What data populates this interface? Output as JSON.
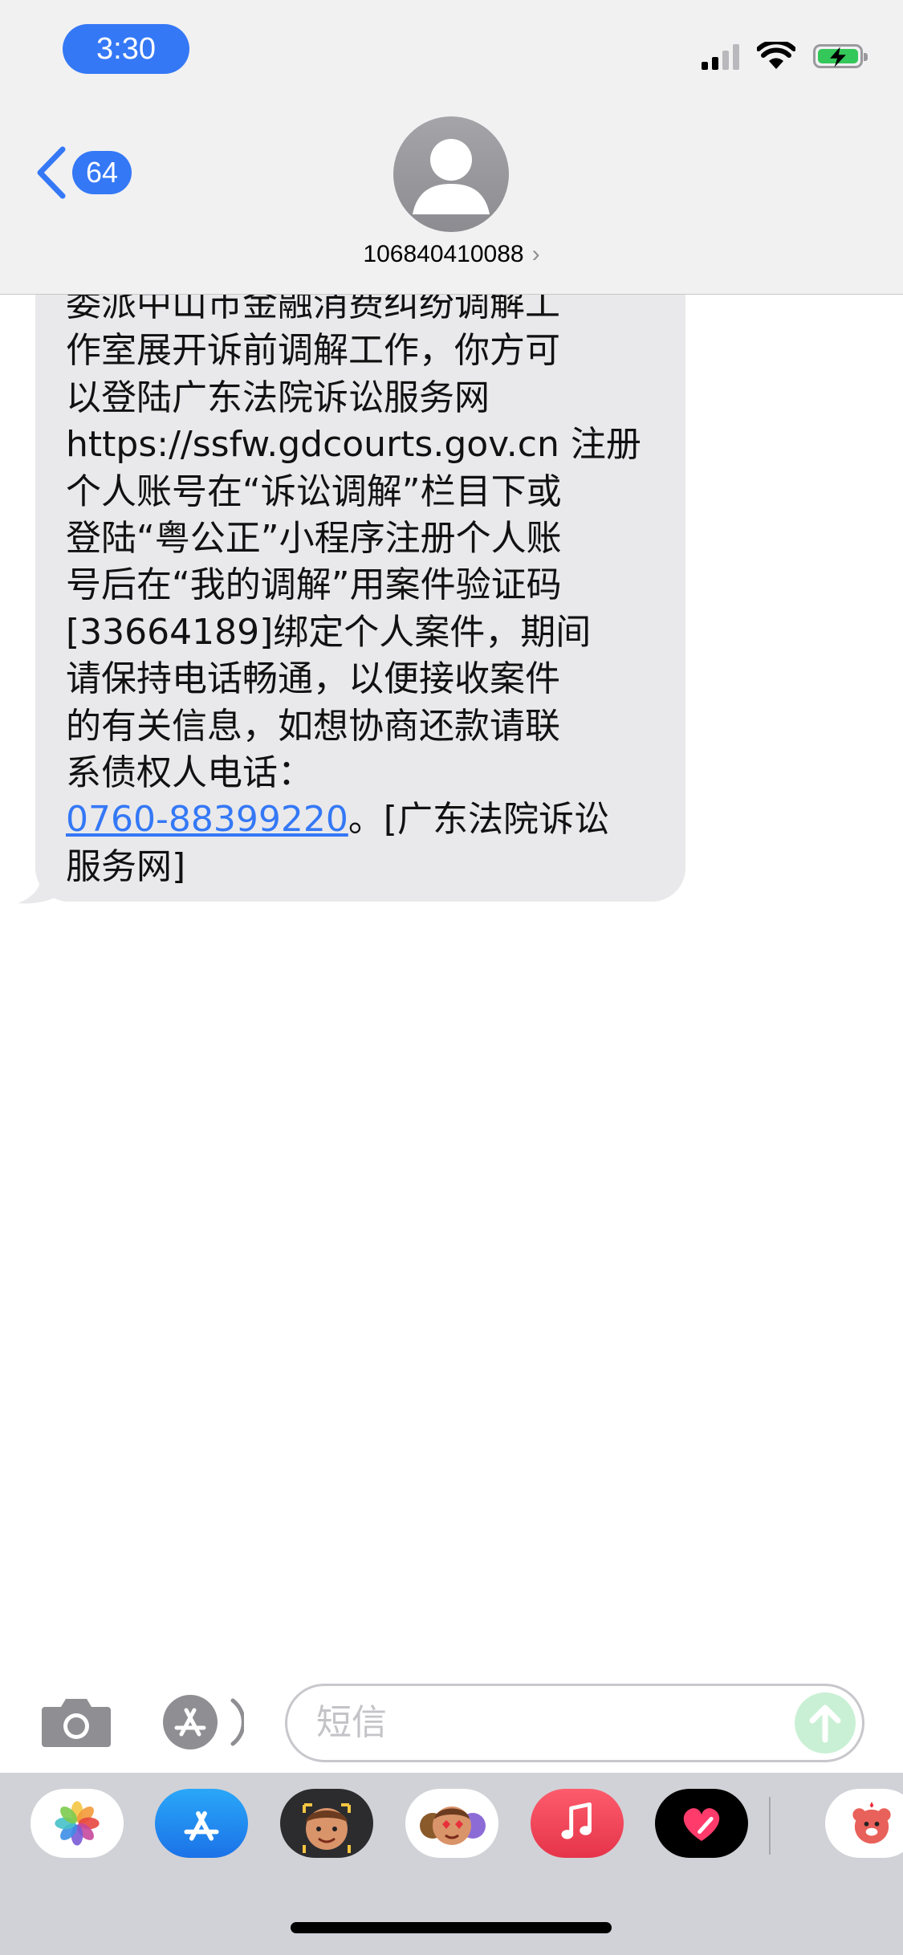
{
  "status_bar": {
    "time": "3:30",
    "signal_bars": 2,
    "battery_charging": true
  },
  "nav": {
    "back_badge": "64",
    "contact": "106840410088",
    "contact_chevron": "›"
  },
  "message": {
    "lines": [
      "委派中山市金融消费纠纷调解工",
      "作室展开诉前调解工作，你方可",
      "以登陆广东法院诉讼服务网",
      "https://ssfw.gdcourts.gov.cn 注册",
      "个人账号在“诉讼调解”栏目下或",
      "登陆“粤公正”小程序注册个人账",
      "号后在“我的调解”用案件验证码",
      "[33664189]绑定个人案件，期间",
      "请保持电话畅通，以便接收案件",
      "的有关信息，如想协商还款请联",
      "系债权人电话："
    ],
    "phone_link": "0760-88399220",
    "after_link": "。[广东法院诉讼",
    "last_line": "服务网]"
  },
  "compose": {
    "placeholder": "短信"
  },
  "drawer_apps": [
    "photos-icon",
    "app-store-icon",
    "memoji-icon",
    "animoji-icon",
    "music-icon",
    "digital-touch-icon",
    "sticker-app-icon"
  ],
  "colors": {
    "accent": "#3478f6",
    "bubble": "#e9e9eb",
    "drawer": "#d1d2d7"
  }
}
